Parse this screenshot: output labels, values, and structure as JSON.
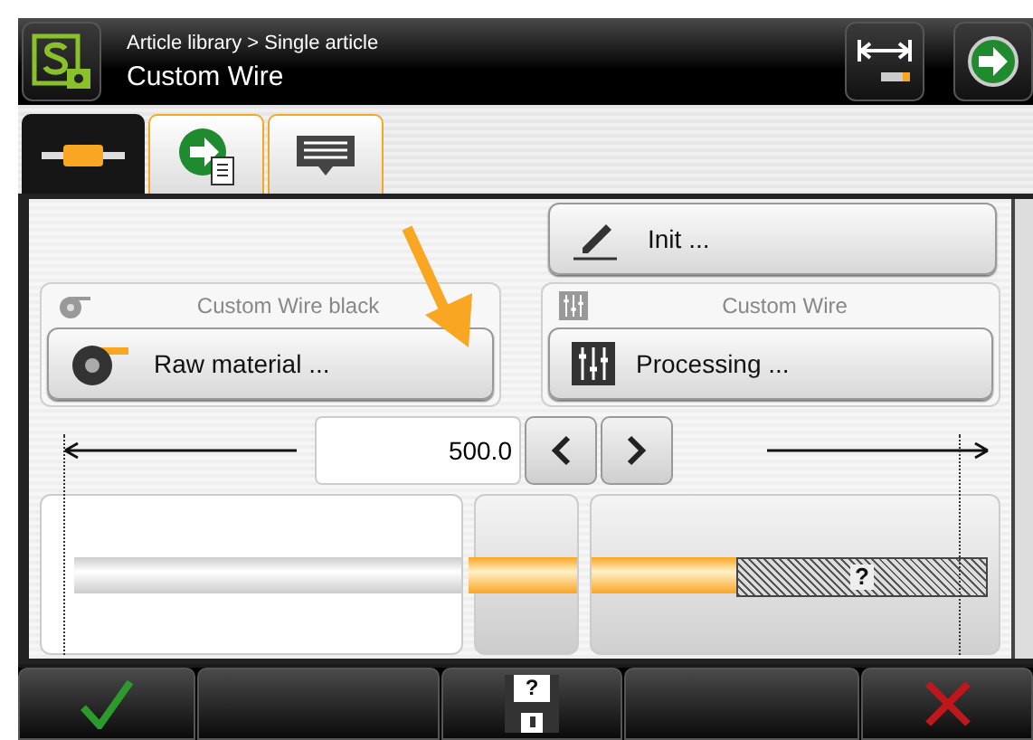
{
  "header": {
    "breadcrumb": "Article library > Single article",
    "title": "Custom Wire"
  },
  "tabs": [
    {
      "kind": "wire",
      "selected": true
    },
    {
      "kind": "forward-doc",
      "selected": false
    },
    {
      "kind": "comment",
      "selected": false
    }
  ],
  "init_button": {
    "label": "Init ..."
  },
  "panels": [
    {
      "kind": "raw",
      "caption": "Custom Wire black",
      "button": "Raw material ..."
    },
    {
      "kind": "processing",
      "caption": "Custom Wire",
      "button": "Processing ..."
    }
  ],
  "length": {
    "value": "500.0"
  },
  "wire": {
    "unknown_mark": "?"
  },
  "bottom_bar": {
    "save_mark": "?"
  }
}
